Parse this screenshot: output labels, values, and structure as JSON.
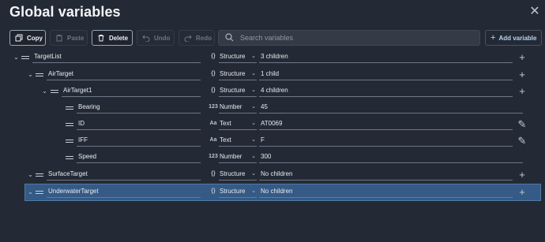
{
  "header": {
    "title": "Global variables",
    "close_icon": "close-icon"
  },
  "toolbar": {
    "copy": "Copy",
    "paste": "Paste",
    "delete": "Delete",
    "undo": "Undo",
    "redo": "Redo",
    "search_placeholder": "Search variables",
    "add_variable": "Add variable"
  },
  "rows": [
    {
      "name": "TargetList",
      "type_icon": "{}",
      "type": "Structure",
      "value": "3 children",
      "action": "+"
    },
    {
      "name": "AirTarget",
      "type_icon": "{}",
      "type": "Structure",
      "value": "1 child",
      "action": "+"
    },
    {
      "name": "AirTarget1",
      "type_icon": "{}",
      "type": "Structure",
      "value": "4 children",
      "action": "+"
    },
    {
      "name": "Bearing",
      "type_icon": "123",
      "type": "Number",
      "value": "45",
      "action": ""
    },
    {
      "name": "ID",
      "type_icon": "Aa",
      "type": "Text",
      "value": "AT0069",
      "action": "✎"
    },
    {
      "name": "IFF",
      "type_icon": "Aa",
      "type": "Text",
      "value": "F",
      "action": "✎"
    },
    {
      "name": "Speed",
      "type_icon": "123",
      "type": "Number",
      "value": "300",
      "action": ""
    },
    {
      "name": "SurfaceTarget",
      "type_icon": "{}",
      "type": "Structure",
      "value": "No children",
      "action": "+"
    },
    {
      "name": "UnderwaterTarget",
      "type_icon": "{}",
      "type": "Structure",
      "value": "No children",
      "action": "+"
    }
  ],
  "colors": {
    "background": "#242a35",
    "selected_row": "#355a85",
    "accent": "#b9d2ea"
  }
}
